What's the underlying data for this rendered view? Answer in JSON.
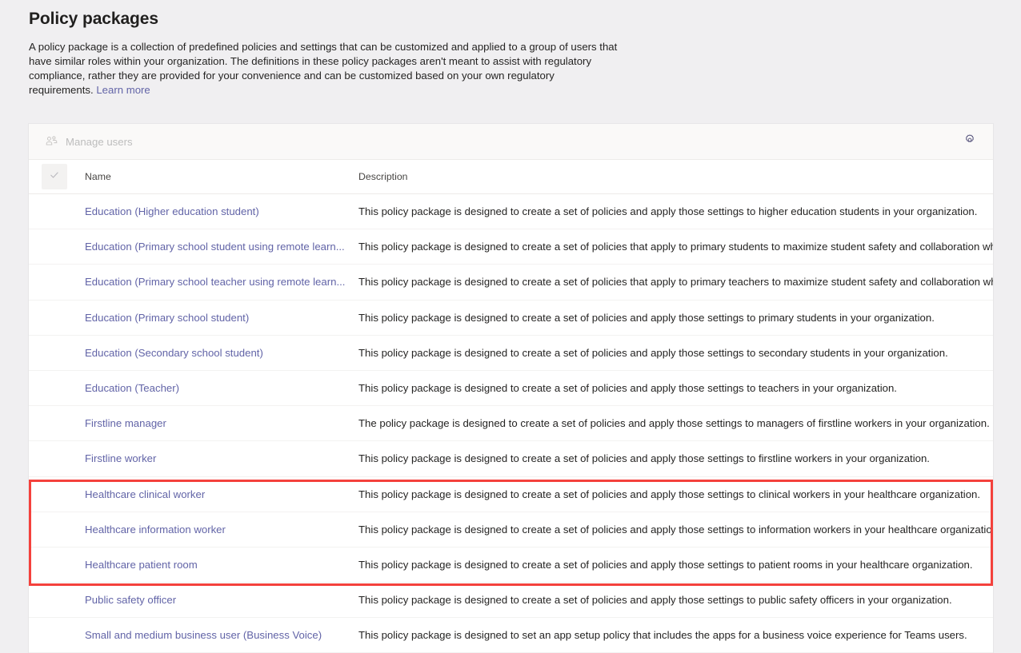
{
  "page": {
    "title": "Policy packages",
    "description": "A policy package is a collection of predefined policies and settings that can be customized and applied to a group of users that have similar roles within your organization. The definitions in these policy packages aren't meant to assist with regulatory compliance, rather they are provided for your convenience and can be customized based on your own regulatory requirements.",
    "learn_more_label": "Learn more"
  },
  "toolbar": {
    "manage_users_label": "Manage users",
    "manage_users_icon": "people-icon",
    "manage_users_disabled": true,
    "settings_icon": "gear-icon"
  },
  "table": {
    "select_all_icon": "checkmark-icon",
    "columns": {
      "name": "Name",
      "description": "Description"
    },
    "rows": [
      {
        "name": "Education (Higher education student)",
        "description": "This policy package is designed to create a set of policies and apply those settings to higher education students in your organization.",
        "highlighted": false
      },
      {
        "name": "Education (Primary school student using remote learn...",
        "description": "This policy package is designed to create a set of policies that apply to primary students to maximize student safety and collaboration wh",
        "highlighted": false
      },
      {
        "name": "Education (Primary school teacher using remote learn...",
        "description": "This policy package is designed to create a set of policies that apply to primary teachers to maximize student safety and collaboration wh",
        "highlighted": false
      },
      {
        "name": "Education (Primary school student)",
        "description": "This policy package is designed to create a set of policies and apply those settings to primary students in your organization.",
        "highlighted": false
      },
      {
        "name": "Education (Secondary school student)",
        "description": "This policy package is designed to create a set of policies and apply those settings to secondary students in your organization.",
        "highlighted": false
      },
      {
        "name": "Education (Teacher)",
        "description": "This policy package is designed to create a set of policies and apply those settings to teachers in your organization.",
        "highlighted": false
      },
      {
        "name": "Firstline manager",
        "description": "The policy package is designed to create a set of policies and apply those settings to managers of firstline workers in your organization.",
        "highlighted": false
      },
      {
        "name": "Firstline worker",
        "description": "This policy package is designed to create a set of policies and apply those settings to firstline workers in your organization.",
        "highlighted": false
      },
      {
        "name": "Healthcare clinical worker",
        "description": "This policy package is designed to create a set of policies and apply those settings to clinical workers in your healthcare organization.",
        "highlighted": true
      },
      {
        "name": "Healthcare information worker",
        "description": "This policy package is designed to create a set of policies and apply those settings to information workers in your healthcare organization.",
        "highlighted": true
      },
      {
        "name": "Healthcare patient room",
        "description": "This policy package is designed to create a set of policies and apply those settings to patient rooms in your healthcare organization.",
        "highlighted": true
      },
      {
        "name": "Public safety officer",
        "description": "This policy package is designed to create a set of policies and apply those settings to public safety officers in your organization.",
        "highlighted": false
      },
      {
        "name": "Small and medium business user (Business Voice)",
        "description": "This policy package is designed to set an app setup policy that includes the apps for a business voice experience for Teams users.",
        "highlighted": false
      }
    ]
  },
  "colors": {
    "link": "#6264a7",
    "highlight_border": "#f4413c",
    "page_background": "#f0eff1",
    "toolbar_background": "#faf9f8"
  }
}
